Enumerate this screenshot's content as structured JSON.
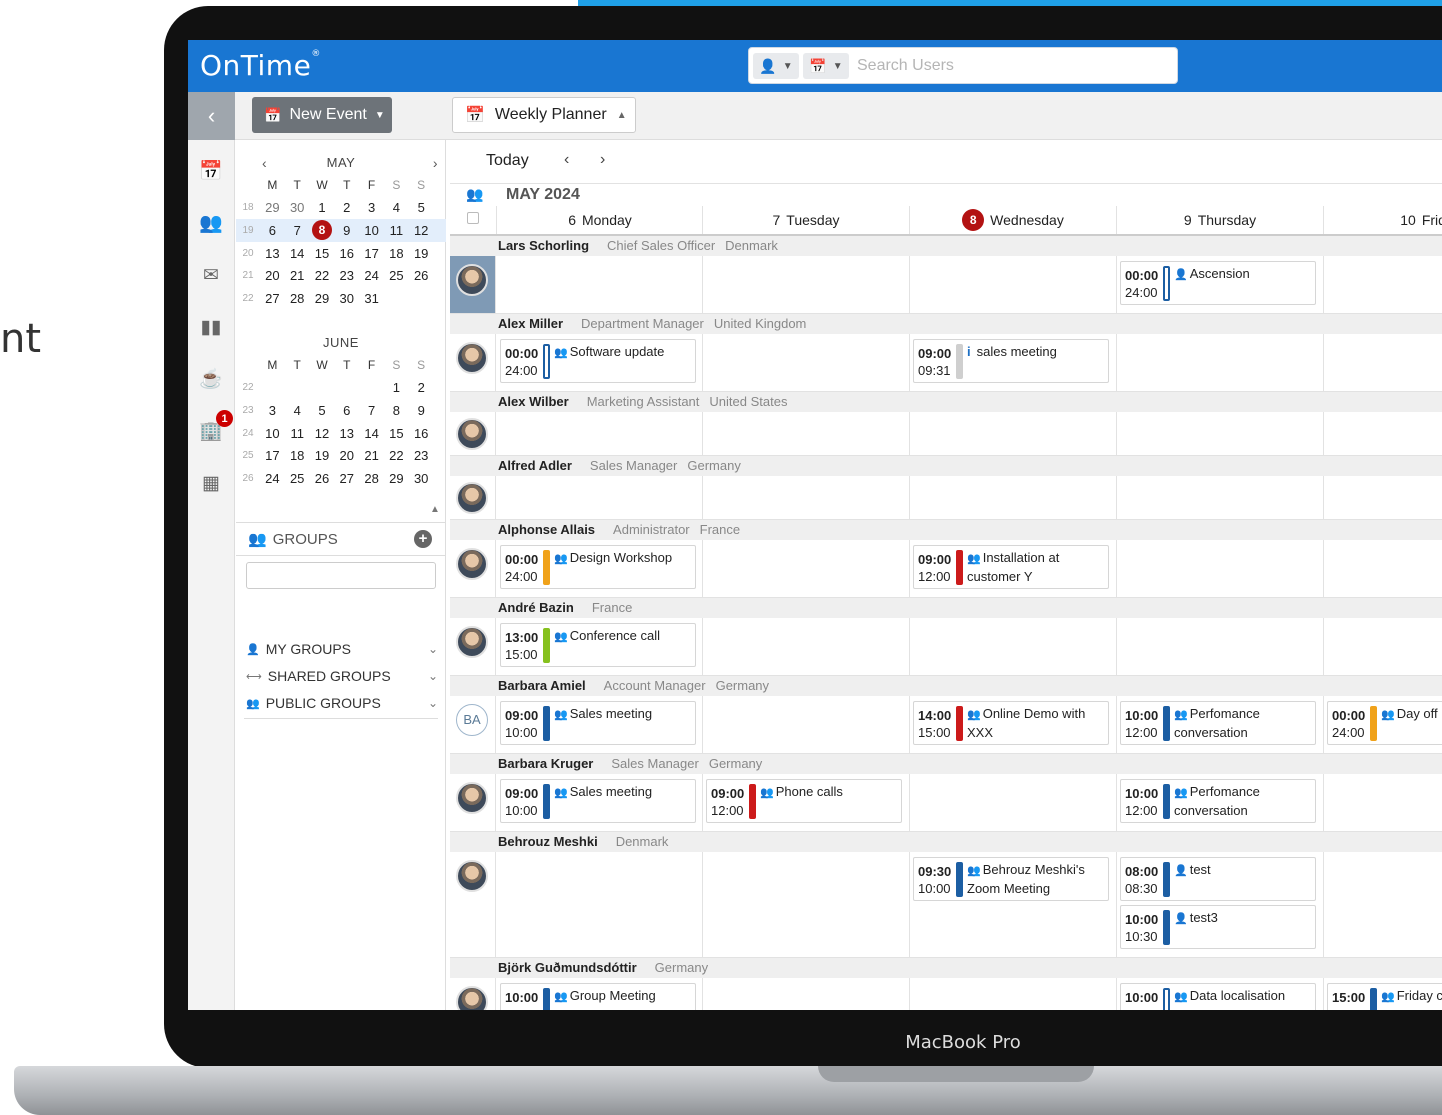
{
  "background_text": "nt",
  "device_label": "MacBook Pro",
  "app": {
    "logo": "OnTime",
    "logo_mark": "®",
    "search_placeholder": "Search Users",
    "new_event_label": "New Event",
    "view_label": "Weekly Planner",
    "nav_badge_count": "1"
  },
  "nav_icons": [
    "calendar-icon",
    "users-icon",
    "mail-icon",
    "chart-icon",
    "coffee-icon",
    "building-icon",
    "apps-grid-icon"
  ],
  "minical": {
    "may": {
      "title": "MAY",
      "dow": [
        "M",
        "T",
        "W",
        "T",
        "F",
        "S",
        "S"
      ],
      "weeks": [
        {
          "wk": "18",
          "days": [
            "29",
            "30",
            "1",
            "2",
            "3",
            "4",
            "5"
          ]
        },
        {
          "wk": "19",
          "days": [
            "6",
            "7",
            "8",
            "9",
            "10",
            "11",
            "12"
          ]
        },
        {
          "wk": "20",
          "days": [
            "13",
            "14",
            "15",
            "16",
            "17",
            "18",
            "19"
          ]
        },
        {
          "wk": "21",
          "days": [
            "20",
            "21",
            "22",
            "23",
            "24",
            "25",
            "26"
          ]
        },
        {
          "wk": "22",
          "days": [
            "27",
            "28",
            "29",
            "30",
            "31",
            "",
            ""
          ]
        }
      ]
    },
    "june": {
      "title": "JUNE",
      "dow": [
        "M",
        "T",
        "W",
        "T",
        "F",
        "S",
        "S"
      ],
      "weeks": [
        {
          "wk": "22",
          "days": [
            "",
            "",
            "",
            "",
            "",
            "1",
            "2"
          ]
        },
        {
          "wk": "23",
          "days": [
            "3",
            "4",
            "5",
            "6",
            "7",
            "8",
            "9"
          ]
        },
        {
          "wk": "24",
          "days": [
            "10",
            "11",
            "12",
            "13",
            "14",
            "15",
            "16"
          ]
        },
        {
          "wk": "25",
          "days": [
            "17",
            "18",
            "19",
            "20",
            "21",
            "22",
            "23"
          ]
        },
        {
          "wk": "26",
          "days": [
            "24",
            "25",
            "26",
            "27",
            "28",
            "29",
            "30"
          ]
        }
      ]
    }
  },
  "groups": {
    "title": "GROUPS",
    "items": [
      "MY GROUPS",
      "SHARED GROUPS",
      "PUBLIC GROUPS"
    ]
  },
  "planner": {
    "today_label": "Today",
    "month_title": "MAY 2024",
    "days": [
      {
        "num": "6",
        "name": "Monday"
      },
      {
        "num": "7",
        "name": "Tuesday"
      },
      {
        "num": "8",
        "name": "Wednesday",
        "today": true
      },
      {
        "num": "9",
        "name": "Thursday"
      },
      {
        "num": "10",
        "name": "Frida"
      }
    ],
    "users": [
      {
        "name": "Lars Schorling",
        "title": "Chief Sales Officer",
        "country": "Denmark",
        "events": [
          {
            "day": 3,
            "start": "00:00",
            "end": "24:00",
            "text": "Ascension",
            "color": "hollow",
            "icon": "person"
          }
        ]
      },
      {
        "name": "Alex Miller",
        "title": "Department Manager",
        "country": "United Kingdom",
        "events": [
          {
            "day": 0,
            "start": "00:00",
            "end": "24:00",
            "text": "Software update",
            "color": "hollow",
            "icon": "people"
          },
          {
            "day": 2,
            "start": "09:00",
            "end": "09:31",
            "text": "sales meeting",
            "color": "#cfcfcf",
            "icon": "info"
          }
        ]
      },
      {
        "name": "Alex Wilber",
        "title": "Marketing Assistant",
        "country": "United States",
        "events": []
      },
      {
        "name": "Alfred Adler",
        "title": "Sales Manager",
        "country": "Germany",
        "events": []
      },
      {
        "name": "Alphonse Allais",
        "title": "Administrator",
        "country": "France",
        "events": [
          {
            "day": 0,
            "start": "00:00",
            "end": "24:00",
            "text": "Design Workshop",
            "color": "#f0a21a",
            "icon": "people"
          },
          {
            "day": 2,
            "start": "09:00",
            "end": "12:00",
            "text": "Installation at customer Y",
            "color": "#cc1a1a",
            "icon": "people"
          }
        ]
      },
      {
        "name": "André Bazin",
        "title": "",
        "country": "France",
        "events": [
          {
            "day": 0,
            "start": "13:00",
            "end": "15:00",
            "text": "Conference call",
            "color": "#86c11e",
            "icon": "people"
          }
        ]
      },
      {
        "name": "Barbara Amiel",
        "title": "Account Manager",
        "country": "Germany",
        "initials": "BA",
        "events": [
          {
            "day": 0,
            "start": "09:00",
            "end": "10:00",
            "text": "Sales meeting",
            "color": "#1c5ea3",
            "icon": "people"
          },
          {
            "day": 2,
            "start": "14:00",
            "end": "15:00",
            "text": "Online Demo with XXX",
            "color": "#cc1a1a",
            "icon": "people"
          },
          {
            "day": 3,
            "start": "10:00",
            "end": "12:00",
            "text": "Perfomance conversation",
            "color": "#1c5ea3",
            "icon": "people"
          },
          {
            "day": 4,
            "start": "00:00",
            "end": "24:00",
            "text": "Day off",
            "color": "#f0a21a",
            "icon": "people"
          }
        ]
      },
      {
        "name": "Barbara Kruger",
        "title": "Sales Manager",
        "country": "Germany",
        "events": [
          {
            "day": 0,
            "start": "09:00",
            "end": "10:00",
            "text": "Sales meeting",
            "color": "#1c5ea3",
            "icon": "people"
          },
          {
            "day": 1,
            "start": "09:00",
            "end": "12:00",
            "text": "Phone calls",
            "color": "#cc1a1a",
            "icon": "people"
          },
          {
            "day": 3,
            "start": "10:00",
            "end": "12:00",
            "text": "Perfomance conversation",
            "color": "#1c5ea3",
            "icon": "people"
          }
        ]
      },
      {
        "name": "Behrouz Meshki",
        "title": "",
        "country": "Denmark",
        "events": [
          {
            "day": 2,
            "start": "09:30",
            "end": "10:00",
            "text": "Behrouz Meshki's Zoom Meeting",
            "color": "#1c5ea3",
            "icon": "people"
          },
          {
            "day": 3,
            "start": "08:00",
            "end": "08:30",
            "text": "test",
            "color": "#1c5ea3",
            "icon": "person"
          },
          {
            "day": 3,
            "start": "10:00",
            "end": "10:30",
            "text": "test3",
            "color": "#1c5ea3",
            "icon": "person",
            "stack": 1
          }
        ]
      },
      {
        "name": "Björk Guðmundsdóttir",
        "title": "",
        "country": "Germany",
        "events": [
          {
            "day": 0,
            "start": "10:00",
            "end": "",
            "text": "Group Meeting",
            "color": "#1c5ea3",
            "icon": "people"
          },
          {
            "day": 3,
            "start": "10:00",
            "end": "",
            "text": "Data localisation",
            "color": "hollow",
            "icon": "people"
          },
          {
            "day": 4,
            "start": "15:00",
            "end": "",
            "text": "Friday cl",
            "color": "#1c5ea3",
            "icon": "people"
          }
        ]
      }
    ]
  }
}
